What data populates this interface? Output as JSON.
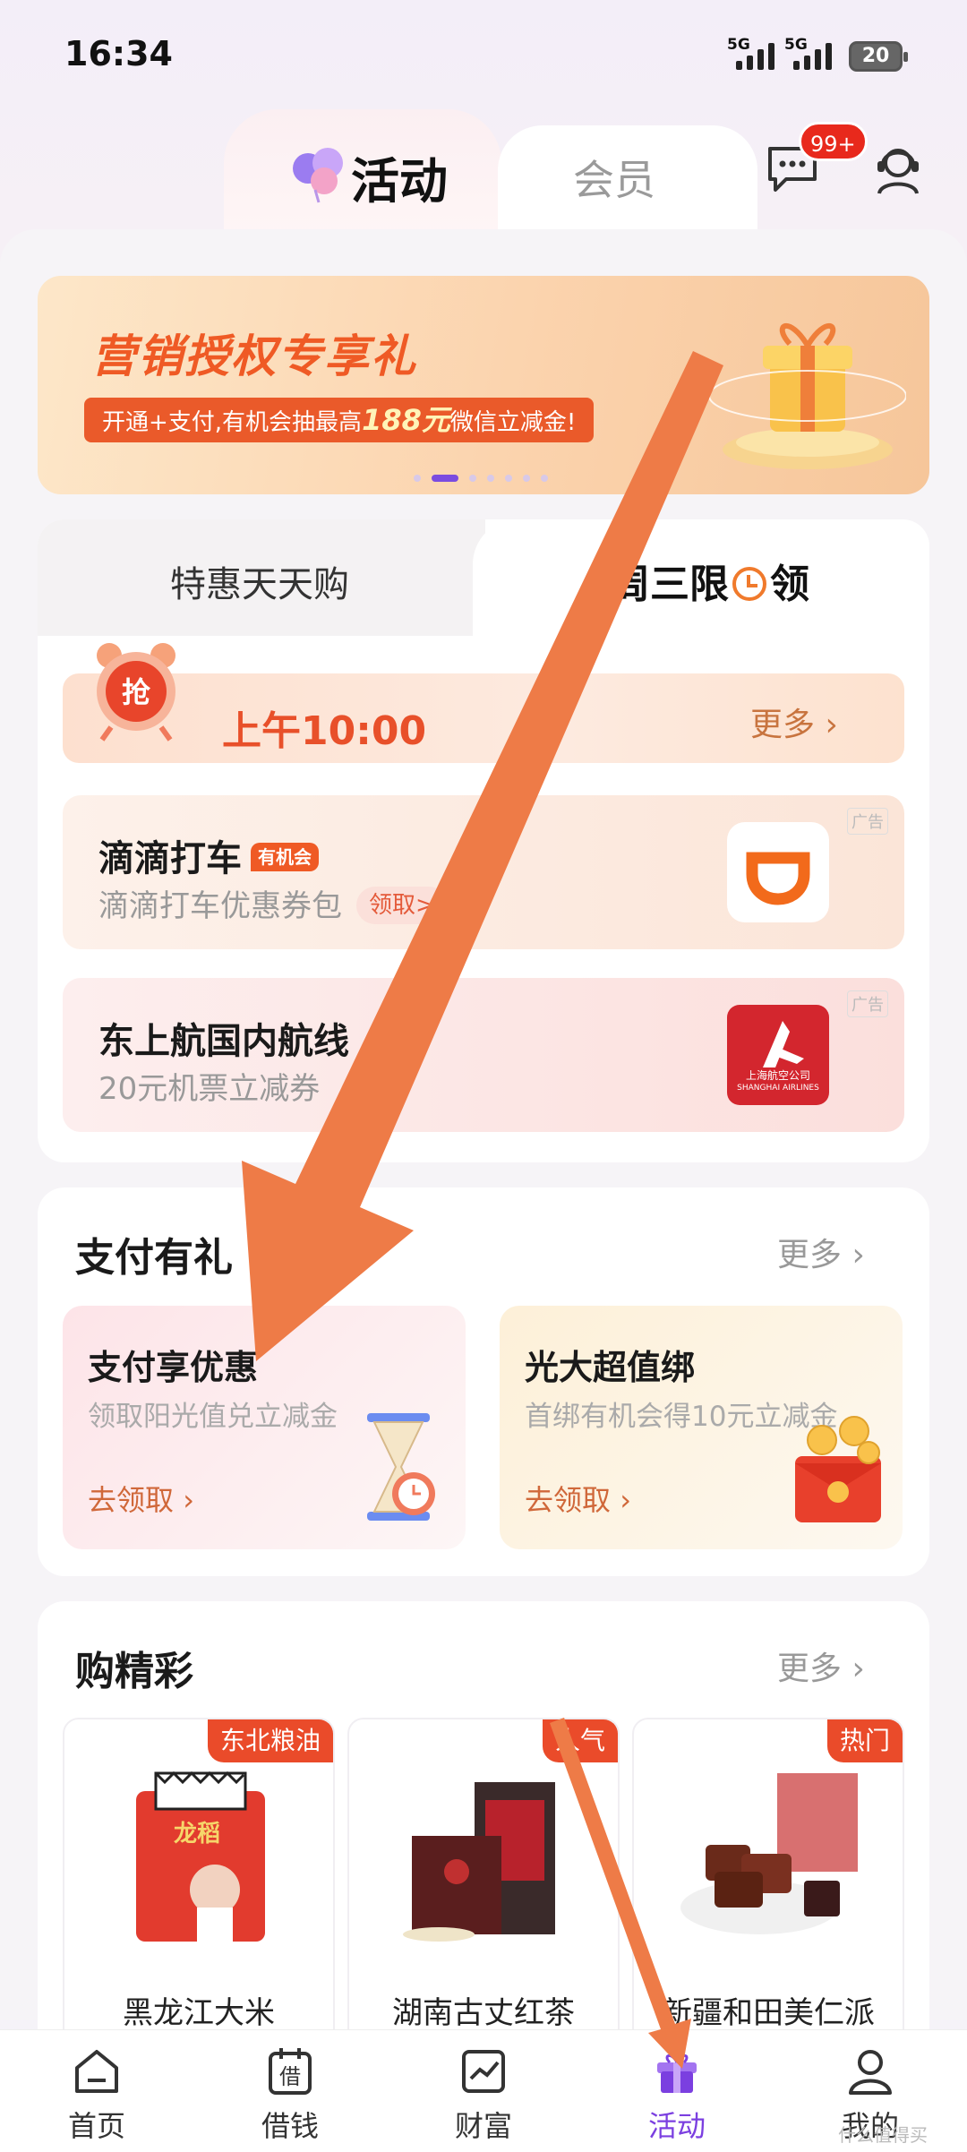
{
  "status_bar": {
    "time": "16:34",
    "signal1": "5G",
    "signal2": "5G",
    "battery": "20"
  },
  "top_tabs": {
    "active": "活动",
    "inactive": "会员",
    "message_badge": "99+"
  },
  "banner": {
    "title": "营销授权专享礼",
    "subtitle_pre": "开通+支付,有机会抽最高",
    "subtitle_amount": "188元",
    "subtitle_post": "微信立减金!"
  },
  "deals": {
    "tab_left": "特惠天天购",
    "tab_right_pre": "周三限",
    "tab_right_post": "领",
    "time_label": "上午10:00",
    "more": "更多",
    "offers": [
      {
        "title": "滴滴打车",
        "tag": "有机会",
        "subtitle": "滴滴打车优惠券包",
        "button": "领取>",
        "ad": "广告",
        "logo": "didi-logo"
      },
      {
        "title": "东上航国内航线",
        "subtitle": "20元机票立减券",
        "ad": "广告",
        "logo": "shanghai-airlines-logo",
        "logo_text_cn": "上海航空公司",
        "logo_text_en": "SHANGHAI AIRLINES"
      }
    ]
  },
  "pay": {
    "title": "支付有礼",
    "more": "更多",
    "cards": [
      {
        "title": "支付享优惠",
        "subtitle": "领取阳光值兑立减金",
        "link": "去领取"
      },
      {
        "title": "光大超值绑",
        "subtitle": "首绑有机会得10元立减金",
        "link": "去领取"
      }
    ]
  },
  "shop": {
    "title": "购精彩",
    "more": "更多",
    "products": [
      {
        "tag": "东北粮油",
        "name": "黑龙江大米"
      },
      {
        "tag": "人气",
        "name": "湖南古丈红茶"
      },
      {
        "tag": "热门",
        "name": "新疆和田美仁派"
      }
    ]
  },
  "nav": {
    "items": [
      {
        "label": "首页",
        "icon": "home-icon"
      },
      {
        "label": "借钱",
        "icon": "loan-icon",
        "icon_char": "借"
      },
      {
        "label": "财富",
        "icon": "wealth-icon"
      },
      {
        "label": "活动",
        "icon": "gift-icon",
        "active": true
      },
      {
        "label": "我的",
        "icon": "profile-icon"
      }
    ]
  },
  "watermark": "什么值得买",
  "colors": {
    "accent": "#7b3fe0",
    "orange": "#ef5a25",
    "arrow": "#ee7b47"
  }
}
